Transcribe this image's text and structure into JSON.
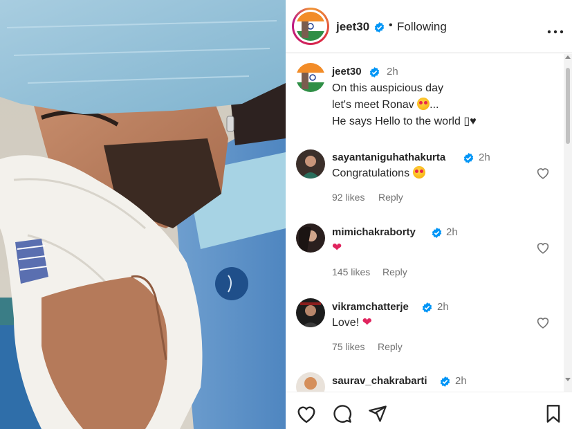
{
  "post": {
    "author": "jeet30",
    "follow_status": "Following",
    "separator": "•"
  },
  "caption": {
    "username": "jeet30",
    "time": "2h",
    "line1": "On this auspicious day",
    "line2": "let's meet Ronav",
    "line2_suffix": "...",
    "line3": "He says Hello to the world",
    "line3_suffix": "▯♥"
  },
  "comments": [
    {
      "username": "sayantaniguhathakurta",
      "time": "2h",
      "text": "Congratulations",
      "emoji": "heart-eyes-emoji",
      "likes": "92 likes",
      "reply": "Reply"
    },
    {
      "username": "mimichakraborty",
      "time": "2h",
      "text": "",
      "emoji": "red-heart-emoji",
      "likes": "145 likes",
      "reply": "Reply"
    },
    {
      "username": "vikramchatterje",
      "time": "2h",
      "text": "Love!",
      "emoji": "red-heart-emoji",
      "likes": "75 likes",
      "reply": "Reply"
    },
    {
      "username": "saurav_chakrabarti",
      "time": "2h"
    }
  ],
  "colors": {
    "verified": "#0095f6",
    "heart": "#e0245e",
    "muted": "#737373",
    "text": "#262626"
  },
  "icons": {
    "like": "heart-outline-icon",
    "comment": "comment-bubble-icon",
    "share": "paper-plane-icon",
    "save": "bookmark-icon",
    "more": "more-options-icon",
    "verified": "verified-badge-icon"
  }
}
